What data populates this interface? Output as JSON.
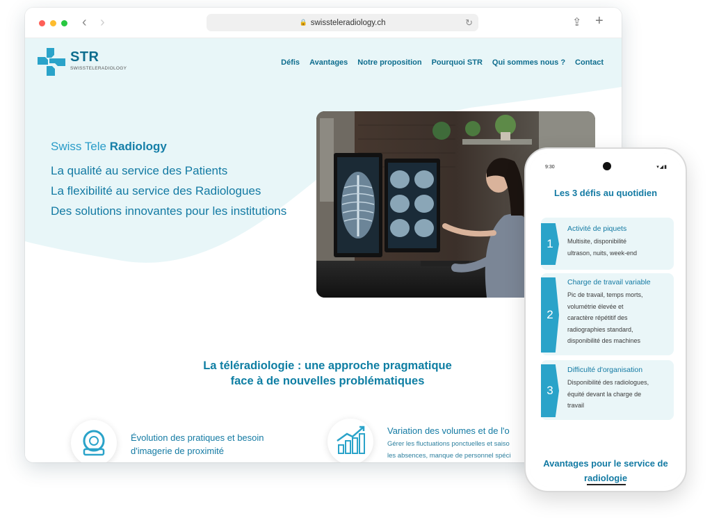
{
  "browser": {
    "url": "swissteleradiology.ch"
  },
  "site": {
    "logo_mark": "STR",
    "logo_sub": "SWISSTELERADIOLOGY",
    "nav": [
      "Défis",
      "Avantages",
      "Notre proposition",
      "Pourquoi STR",
      "Qui sommes nous ?",
      "Contact"
    ],
    "hero": {
      "title_plain": "Swiss Tele ",
      "title_bold": "Radiology",
      "lines": [
        "La qualité au service des Patients",
        "La flexibilité au service des Radiologues",
        "Des solutions innovantes pour les institutions"
      ]
    },
    "section_title_1": "La téléradiologie : une approche pragmatique",
    "section_title_2": "face à de nouvelles problématiques",
    "features": [
      {
        "icon": "mri-scanner-icon",
        "title_1": "Évolution des pratiques et besoin",
        "title_2": "d'imagerie de proximité"
      },
      {
        "icon": "growth-chart-icon",
        "title_1": "Variation des volumes et de l'o",
        "text_1": "Gérer les fluctuations ponctuelles et saiso",
        "text_2": "les absences, manque de personnel spéci"
      }
    ]
  },
  "phone": {
    "time": "9:30",
    "title": "Les 3 défis au quotidien",
    "cards": [
      {
        "num": "1",
        "title": "Activité de piquets",
        "lines": [
          "Multisite, disponibilité",
          "ultrason, nuits, week-end"
        ]
      },
      {
        "num": "2",
        "title": "Charge de travail variable",
        "lines": [
          "Pic de travail, temps morts,",
          "volumétrie élevée et",
          "caractère répétitif des",
          "radiographies standard,",
          "disponibilité des machines"
        ]
      },
      {
        "num": "3",
        "title": "Difficulté d'organisation",
        "lines": [
          "Disponibilité des radiologues,",
          "équité devant la charge de",
          "travail"
        ]
      }
    ],
    "bottom_1": "Avantages pour le service de",
    "bottom_2": "radiologie"
  },
  "colors": {
    "primary": "#137aa3",
    "accent": "#2aa3c9",
    "hero_bg": "#e8f6f8"
  }
}
